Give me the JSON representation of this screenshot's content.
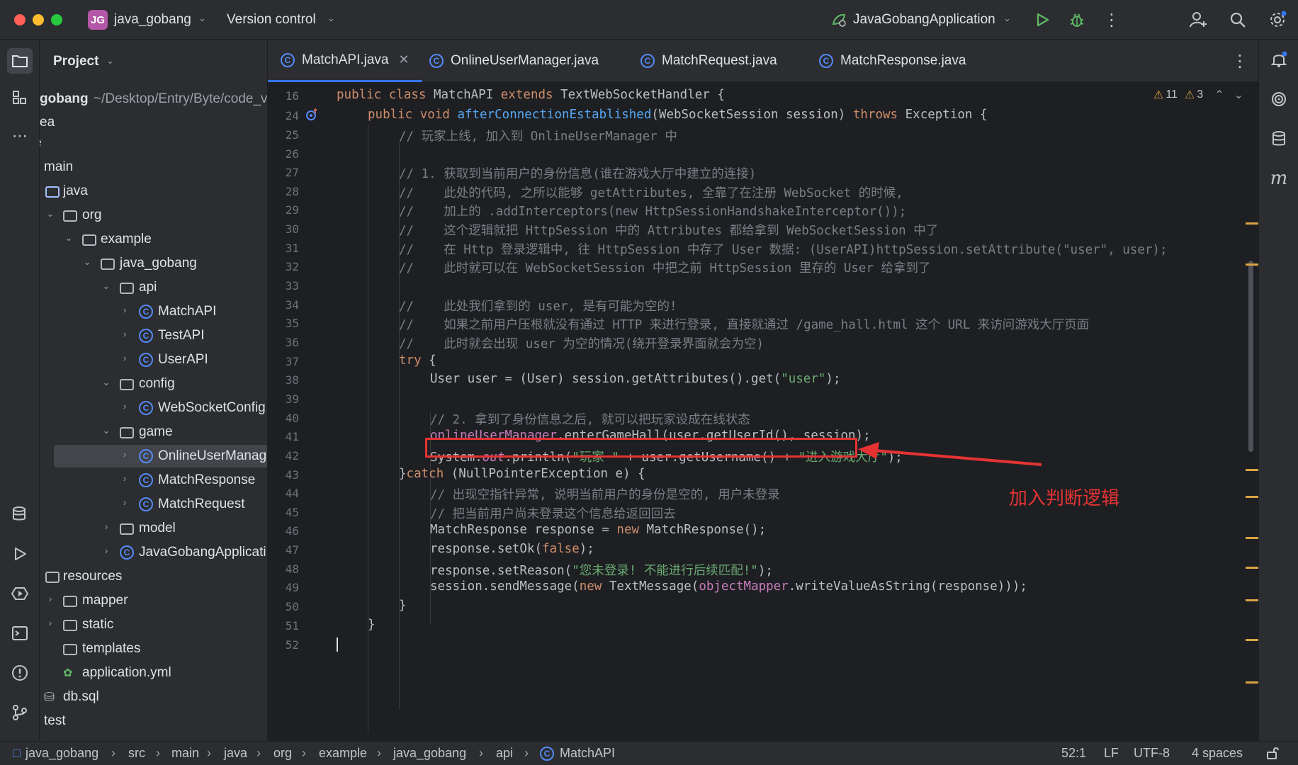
{
  "titlebar": {
    "project_badge": "JG",
    "project_name": "java_gobang",
    "vcs": "Version control",
    "run_config": "JavaGobangApplication"
  },
  "project_panel": {
    "title": "Project",
    "root": {
      "name": "gobang",
      "path": "~/Desktop/Entry/Byte/code_v"
    },
    "rows": [
      {
        "label": "ea"
      },
      {
        "label": "e"
      },
      {
        "label": "main"
      },
      {
        "label": "java"
      },
      {
        "label": "org"
      },
      {
        "label": "example"
      },
      {
        "label": "java_gobang"
      },
      {
        "label": "api"
      },
      {
        "label": "MatchAPI"
      },
      {
        "label": "TestAPI"
      },
      {
        "label": "UserAPI"
      },
      {
        "label": "config"
      },
      {
        "label": "WebSocketConfig"
      },
      {
        "label": "game"
      },
      {
        "label": "OnlineUserManag"
      },
      {
        "label": "MatchResponse"
      },
      {
        "label": "MatchRequest"
      },
      {
        "label": "model"
      },
      {
        "label": "JavaGobangApplicati"
      },
      {
        "label": "resources"
      },
      {
        "label": "mapper"
      },
      {
        "label": "static"
      },
      {
        "label": "templates"
      },
      {
        "label": "application.yml"
      },
      {
        "label": "db.sql"
      },
      {
        "label": "test"
      }
    ]
  },
  "tabs": [
    {
      "label": "MatchAPI.java",
      "active": true
    },
    {
      "label": "OnlineUserManager.java"
    },
    {
      "label": "MatchRequest.java"
    },
    {
      "label": "MatchResponse.java"
    }
  ],
  "editor": {
    "warnings": "11",
    "weak_warnings": "3",
    "line_numbers": [
      "16",
      "24",
      "25",
      "26",
      "27",
      "28",
      "29",
      "30",
      "31",
      "32",
      "33",
      "34",
      "35",
      "36",
      "37",
      "38",
      "39",
      "40",
      "41",
      "42",
      "43",
      "44",
      "45",
      "46",
      "47",
      "48",
      "49",
      "50",
      "51",
      "52"
    ],
    "code": {
      "l16": {
        "a": "public class ",
        "b": "MatchAPI ",
        "c": "extends ",
        "d": "TextWebSocketHandler {"
      },
      "l24": {
        "a": "public void ",
        "b": "afterConnectionEstablished",
        "c": "(WebSocketSession session) ",
        "d": "throws ",
        "e": "Exception {"
      },
      "l25": "// 玩家上线, 加入到 OnlineUserManager 中",
      "l27": "// 1. 获取到当前用户的身份信息(谁在游戏大厅中建立的连接)",
      "l28": "//    此处的代码, 之所以能够 getAttributes, 全靠了在注册 WebSocket 的时候,",
      "l29": "//    加上的 .addInterceptors(new HttpSessionHandshakeInterceptor());",
      "l30": "//    这个逻辑就把 HttpSession 中的 Attributes 都给拿到 WebSocketSession 中了",
      "l31": "//    在 Http 登录逻辑中, 往 HttpSession 中存了 User 数据: (UserAPI)httpSession.setAttribute(\"user\", user);",
      "l32": "//    此时就可以在 WebSocketSession 中把之前 HttpSession 里存的 User 给拿到了",
      "l34": "//    此处我们拿到的 user, 是有可能为空的!",
      "l35": "//    如果之前用户压根就没有通过 HTTP 来进行登录, 直接就通过 /game_hall.html 这个 URL 来访问游戏大厅页面",
      "l36": "//    此时就会出现 user 为空的情况(绕开登录界面就会为空)",
      "l37": {
        "a": "try",
        "b": " {"
      },
      "l38": {
        "a": "User user = (User) session.getAttributes().get(",
        "b": "\"user\"",
        "c": ");"
      },
      "l40": "// 2. 拿到了身份信息之后, 就可以把玩家设成在线状态",
      "l41": {
        "a": "onlineUserManager",
        "b": ".enterGameHall(user.getUserId(), session);"
      },
      "l42": {
        "a": "System.",
        "b": "out",
        "c": ".println(",
        "d": "\"玩家 \"",
        "e": " + user.getUsername() + ",
        "f": "\"进入游戏大厅\"",
        "g": ");"
      },
      "l43": {
        "a": "}",
        "b": "catch",
        "c": " (NullPointerException e) {"
      },
      "l44": "// 出现空指针异常, 说明当前用户的身份是空的, 用户未登录",
      "l45": "// 把当前用户尚未登录这个信息给返回回去",
      "l46": {
        "a": "MatchResponse response = ",
        "b": "new ",
        "c": "MatchResponse();"
      },
      "l47": {
        "a": "response.setOk(",
        "b": "false",
        "c": ");"
      },
      "l48": {
        "a": "response.setReason(",
        "b": "\"您未登录! 不能进行后续匹配!\"",
        "c": ");"
      },
      "l49": {
        "a": "session.sendMessage(",
        "b": "new ",
        "c": "TextMessage(",
        "d": "objectMapper",
        "e": ".writeValueAsString(response)));"
      },
      "l50": "}",
      "l51": "}"
    }
  },
  "annotation": {
    "text": "加入判断逻辑",
    "color": "#e53333"
  },
  "statusbar": {
    "breadcrumb": [
      "java_gobang",
      "src",
      "main",
      "java",
      "org",
      "example",
      "java_gobang",
      "api",
      "MatchAPI"
    ],
    "position": "52:1",
    "line_sep": "LF",
    "encoding": "UTF-8",
    "indent": "4 spaces"
  }
}
